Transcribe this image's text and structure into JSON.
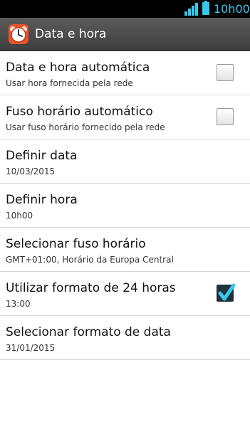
{
  "status_bar": {
    "time": "10h00",
    "signal_icon": "signal-icon",
    "battery_icon": "battery-icon"
  },
  "header": {
    "title": "Data e hora",
    "icon": "alarm-clock-icon"
  },
  "settings": [
    {
      "title": "Data e hora automática",
      "subtitle": "Usar hora fornecida pela rede",
      "checkbox": false
    },
    {
      "title": "Fuso horário automático",
      "subtitle": "Usar fuso horário fornecido pela rede",
      "checkbox": false
    },
    {
      "title": "Definir data",
      "subtitle": "10/03/2015"
    },
    {
      "title": "Definir hora",
      "subtitle": "10h00"
    },
    {
      "title": "Selecionar fuso horário",
      "subtitle": "GMT+01:00, Horário da Europa Central"
    },
    {
      "title": "Utilizar formato de 24 horas",
      "subtitle": "13:00",
      "checkbox": true
    },
    {
      "title": "Selecionar formato de data",
      "subtitle": "31/01/2015"
    }
  ],
  "colors": {
    "accent": "#37c8ee",
    "header_bg": "#4a4a4a",
    "check_bg": "#22323a"
  }
}
